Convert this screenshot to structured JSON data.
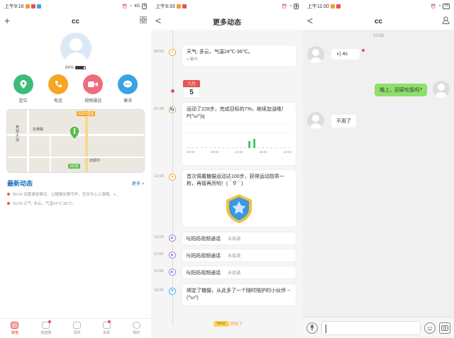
{
  "colors": {
    "accent": "#1c6fbf",
    "red": "#e45454",
    "orange": "#f0a03a",
    "green": "#48c774",
    "chat_bubble": "#8ee06a"
  },
  "screen1": {
    "status": {
      "time": "上午9:16",
      "signal": "4G",
      "battery": "4"
    },
    "title": "cc",
    "add_icon": "+",
    "grid_icon": "grid-icon",
    "battery_pct": "84%",
    "actions": [
      {
        "label": "定位",
        "icon": "location-icon",
        "color": "#3dbb7a"
      },
      {
        "label": "电话",
        "icon": "phone-icon",
        "color": "#f6a623"
      },
      {
        "label": "视频通话",
        "icon": "video-icon",
        "color": "#ef6c7d"
      },
      {
        "label": "聊天",
        "icon": "chat-icon",
        "color": "#3aa3e3"
      }
    ],
    "map": {
      "labels": [
        "东莞路",
        "黄部大道",
        "G207国道",
        "抚顺村"
      ],
      "badge": "3秒前"
    },
    "news": {
      "title": "最新动态",
      "more": "更多 >",
      "items": [
        "08:00  设置课堂模式，让糖猫安静守护，宝宝专心上课哦。v...",
        "00:00  天气: 多云，气温24℃-36℃。"
      ]
    },
    "tabs": [
      "糖猫",
      "家庭圈",
      "团购",
      "看看",
      "我的"
    ]
  },
  "screen2": {
    "status": {
      "time": "上午9:33"
    },
    "title": "更多动态",
    "back": "<",
    "weather": {
      "time": "00:00",
      "text": "天气: 多云，气温24℃-36℃。",
      "place": "襄州"
    },
    "date": {
      "month": "六月",
      "day": "5"
    },
    "steps": {
      "time": "21:08",
      "text": "运动了228步，完成目标的7%，继续加油哦！P(^ω^)q",
      "ticks": [
        "00:00",
        "06:00",
        "12:00",
        "18:00",
        "23:00"
      ],
      "values": [
        0,
        0,
        0,
        0,
        0,
        0,
        0,
        0,
        0,
        0,
        0,
        0,
        0,
        0,
        40,
        60,
        0,
        0,
        0,
        0,
        0,
        0,
        0,
        0
      ]
    },
    "medal": {
      "time": "12:00",
      "text": "首次佩戴糖猫运动达100步，获得运动勋章一枚，再接再厉哟！(＾∇＾)"
    },
    "calls": [
      {
        "time": "12:00",
        "text": "与妈妈视频通话",
        "status": "未接通"
      },
      {
        "time": "11:59",
        "text": "与妈妈视频通话",
        "status": "未接通"
      },
      {
        "time": "11:58",
        "text": "与妈妈视频通话",
        "status": "未接通"
      }
    ],
    "bind": {
      "time": "10:55",
      "text": "绑定了糖猫，从此多了一个随时陪护的小伙伴 ~ (^ω^)"
    },
    "end": {
      "badge": "TANG",
      "text": "到底了"
    }
  },
  "screen3": {
    "status": {
      "time": "上午11:00",
      "battery": "77"
    },
    "title": "cc",
    "back": "<",
    "timestamp": "10:59",
    "voice": {
      "duration": "4s"
    },
    "me_msg": "晚上，回家吃饭吗?",
    "reply": "不用了"
  }
}
